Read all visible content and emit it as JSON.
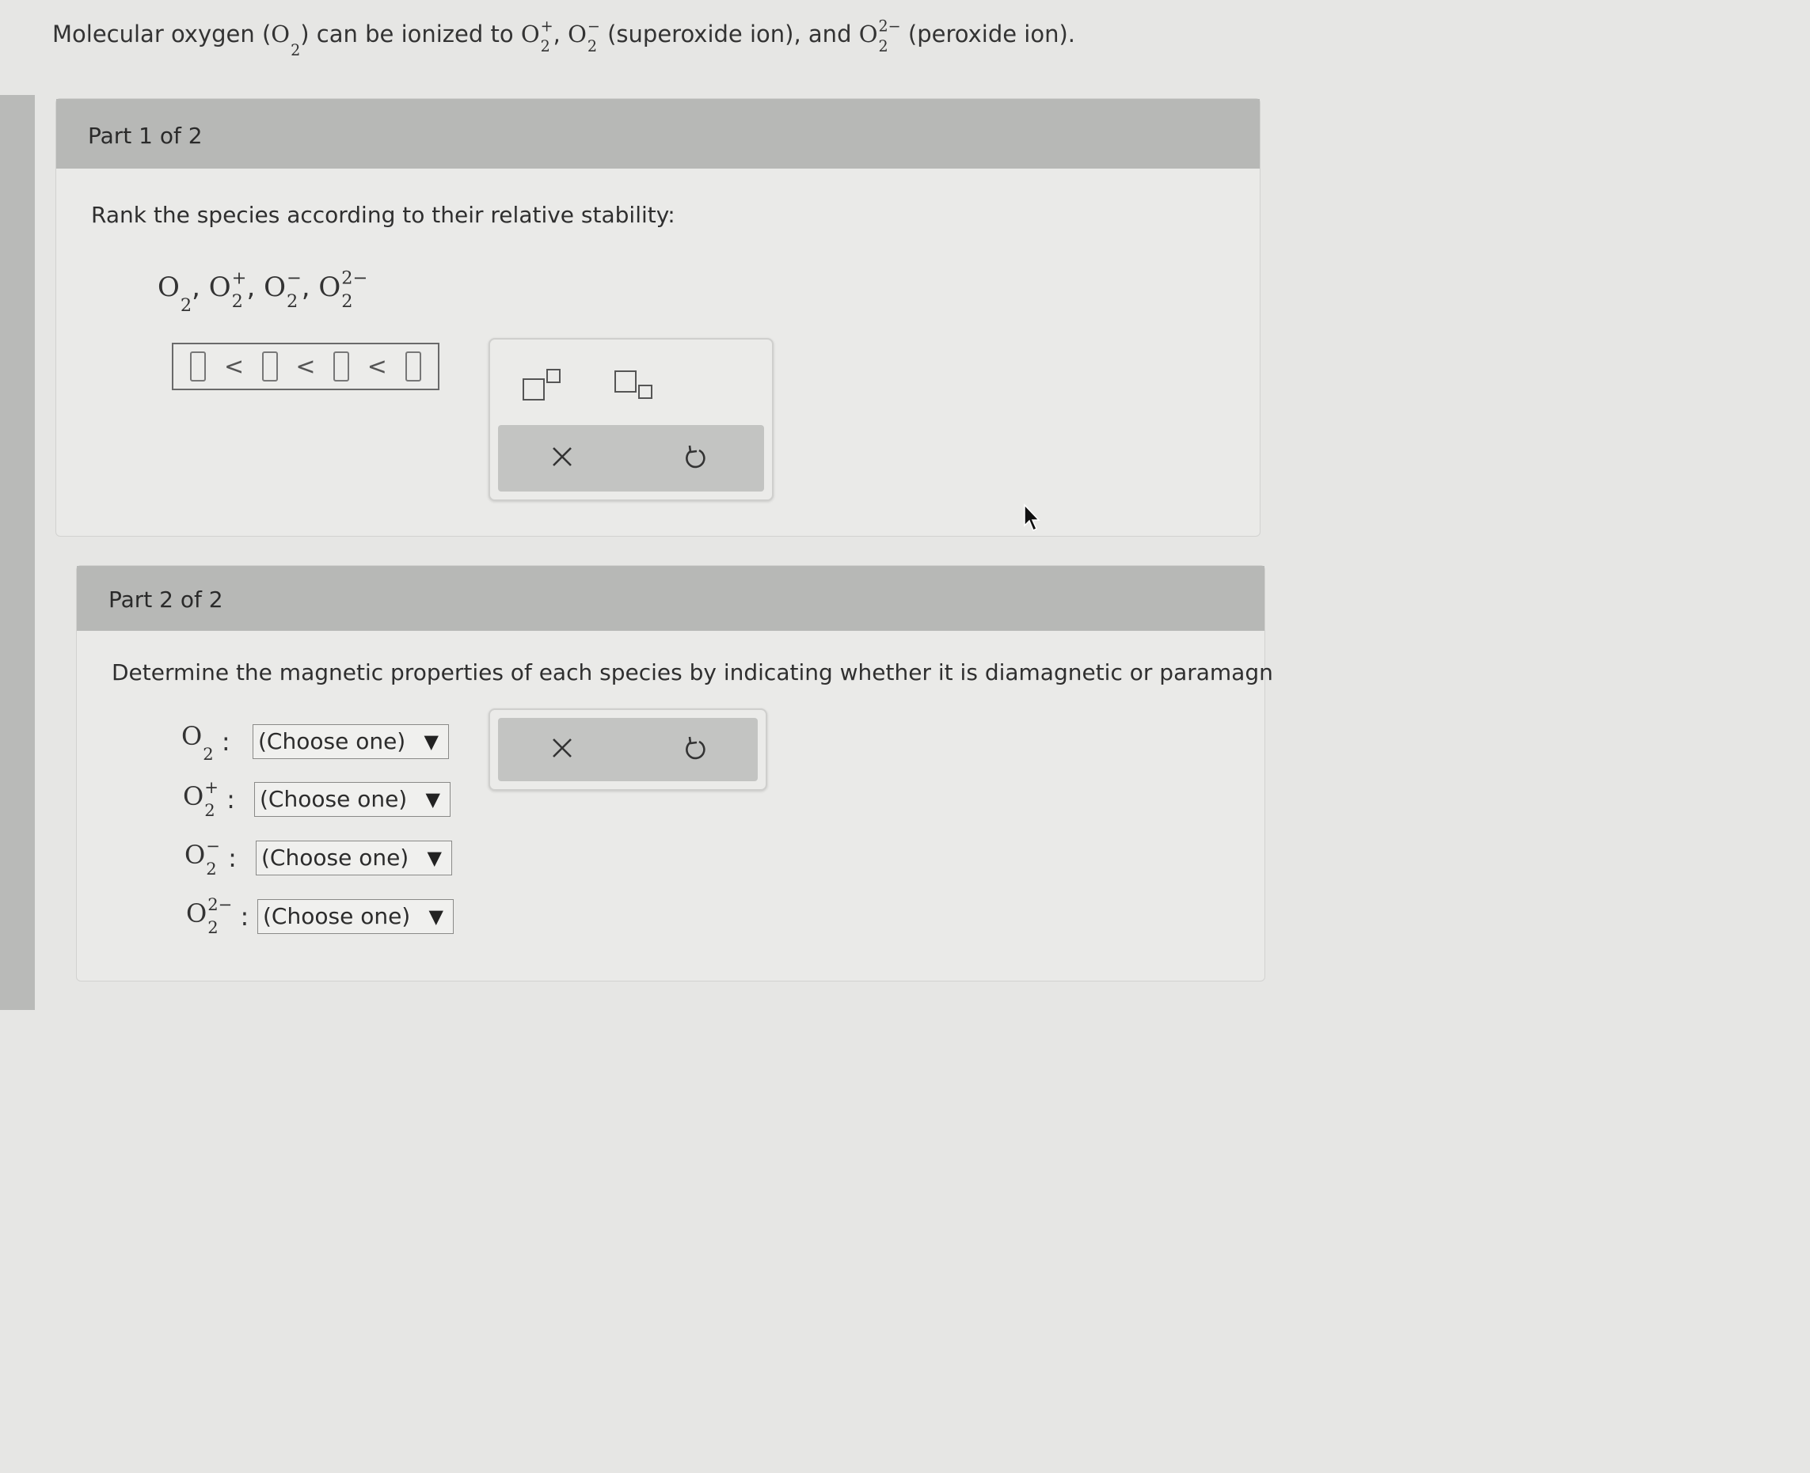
{
  "intro": {
    "text1": "Molecular oxygen (",
    "o2": {
      "el": "O",
      "sub": "2"
    },
    "text2": ") can be ionized to ",
    "o2plus": {
      "el": "O",
      "sub": "2",
      "sup": "+"
    },
    "comma": ", ",
    "o2minus": {
      "el": "O",
      "sub": "2",
      "sup": "−"
    },
    "text3": " (superoxide ion), and ",
    "o22minus": {
      "el": "O",
      "sub": "2",
      "sup": "2−"
    },
    "text4": " (peroxide ion)."
  },
  "part1": {
    "header": "Part 1 of 2",
    "prompt": "Rank the species according to their relative stability:",
    "species": [
      {
        "el": "O",
        "sub": "2",
        "sup": ""
      },
      {
        "el": "O",
        "sub": "2",
        "sup": "+"
      },
      {
        "el": "O",
        "sub": "2",
        "sup": "−"
      },
      {
        "el": "O",
        "sub": "2",
        "sup": "2−"
      }
    ],
    "separator": ", ",
    "lt_symbol": "<",
    "tools": {
      "superscript_icon": "superscript-icon",
      "subscript_icon": "subscript-icon",
      "clear_label": "×",
      "undo_icon": "undo-icon"
    }
  },
  "part2": {
    "header": "Part 2 of 2",
    "prompt": "Determine the magnetic properties of each species by indicating whether it is diamagnetic or paramagn",
    "rows": [
      {
        "el": "O",
        "sub": "2",
        "sup": "",
        "colon": ":",
        "select": "(Choose one)"
      },
      {
        "el": "O",
        "sub": "2",
        "sup": "+",
        "colon": ":",
        "select": "(Choose one)"
      },
      {
        "el": "O",
        "sub": "2",
        "sup": "−",
        "colon": ":",
        "select": "(Choose one)"
      },
      {
        "el": "O",
        "sub": "2",
        "sup": "2−",
        "colon": ":",
        "select": "(Choose one)"
      }
    ],
    "tools": {
      "clear_label": "×",
      "undo_icon": "undo-icon"
    }
  },
  "colors": {
    "background": "#e6e6e4",
    "header": "#b7b8b6",
    "panel": "#eaeae8",
    "toolbar": "#c3c4c2"
  }
}
